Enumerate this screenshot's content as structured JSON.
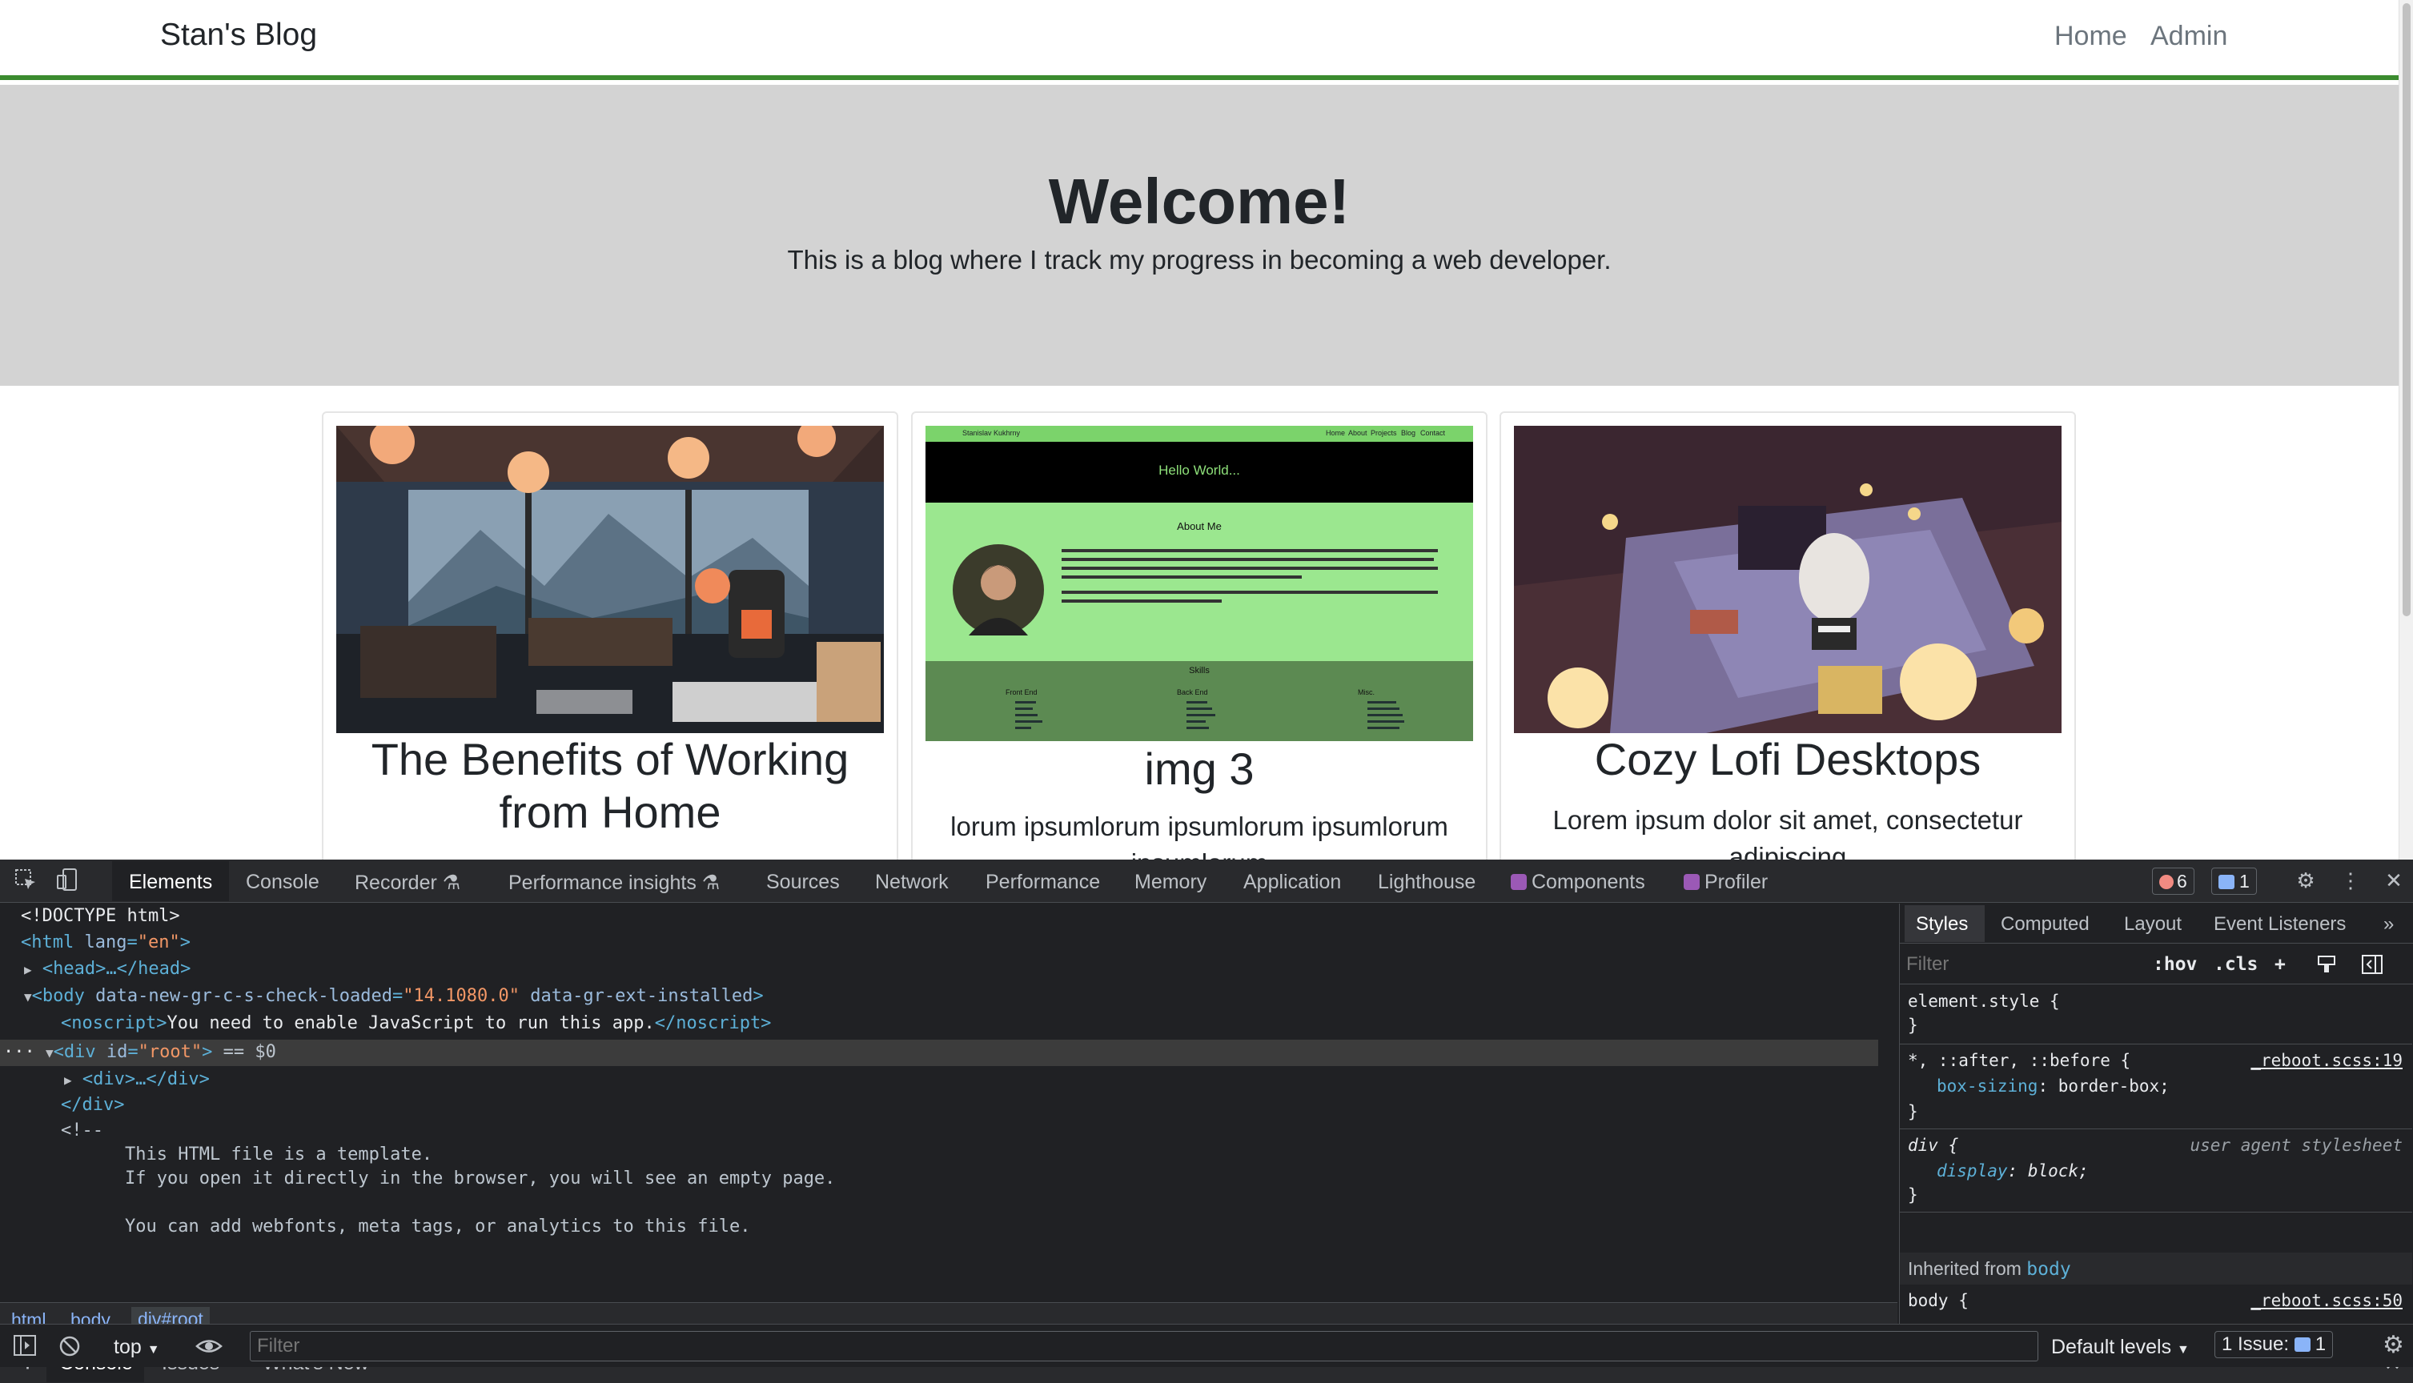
{
  "page": {
    "brand": "Stan's Blog",
    "nav": {
      "home": "Home",
      "admin": "Admin"
    },
    "hero": {
      "title": "Welcome!",
      "subtitle": "This is a blog where I track my progress in becoming a web developer."
    },
    "cards": [
      {
        "title": "The Benefits of Working from Home",
        "text": ""
      },
      {
        "title": "img 3",
        "text": "lorum ipsumlorum ipsumlorum ipsumlorum ipsumlorum"
      },
      {
        "title": "Cozy Lofi Desktops",
        "text": "Lorem ipsum dolor sit amet, consectetur adipiscing"
      }
    ],
    "screenshot_card": {
      "name": "Stanislav Kukhrny",
      "nav_items": [
        "Home",
        "About",
        "Projects",
        "Blog",
        "Contact"
      ],
      "hello": "Hello World...",
      "about_heading": "About Me",
      "skills_heading": "Skills",
      "skill_cols": [
        "Front End",
        "Back End",
        "Misc."
      ]
    }
  },
  "devtools": {
    "tabs": [
      "Elements",
      "Console",
      "Recorder",
      "Performance insights",
      "Sources",
      "Network",
      "Performance",
      "Memory",
      "Application",
      "Lighthouse",
      "Components",
      "Profiler"
    ],
    "active_tab": "Elements",
    "error_count": "6",
    "message_count": "1",
    "dom": {
      "doctype": "<!DOCTYPE html>",
      "html_open": "<html",
      "lang_attr": "lang",
      "lang_val": "\"en\"",
      "head": "<head>…</head>",
      "body_tag": "<body",
      "body_attr1": "data-new-gr-c-s-check-loaded",
      "body_val1": "\"14.1080.0\"",
      "body_attr2": "data-gr-ext-installed",
      "noscript_open": "<noscript>",
      "noscript_text": "You need to enable JavaScript to run this app.",
      "noscript_close": "</noscript>",
      "root_div": "<div",
      "root_attr": "id",
      "root_val": "\"root\"",
      "root_eq": "== $0",
      "child_div": "<div>…</div>",
      "close_div": "</div>",
      "comment_open": "<!--",
      "comment_line1": "This HTML file is a template.",
      "comment_line2": "If you open it directly in the browser, you will see an empty page.",
      "comment_line3": "You can add webfonts, meta tags, or analytics to this file."
    },
    "breadcrumbs": [
      "html",
      "body",
      "div#root"
    ],
    "styles": {
      "tabs": [
        "Styles",
        "Computed",
        "Layout",
        "Event Listeners"
      ],
      "filter_placeholder": "Filter",
      "hov": ":hov",
      "cls": ".cls",
      "rule1_selector": "element.style {",
      "rule2_selector": "*, ::after, ::before {",
      "rule2_source": "_reboot.scss:19",
      "rule2_prop": "box-sizing",
      "rule2_value": "border-box;",
      "rule3_selector": "div {",
      "rule3_source": "user agent stylesheet",
      "rule3_prop": "display",
      "rule3_value": "block;",
      "inherited_label": "Inherited from",
      "inherited_from": "body",
      "rule4_selector": "body {",
      "rule4_source": "_reboot.scss:50"
    },
    "drawer": {
      "tabs": [
        "Console",
        "Issues",
        "What's New"
      ],
      "context": "top",
      "filter_placeholder": "Filter",
      "levels": "Default levels",
      "issues_label": "1 Issue:",
      "issues_count": "1"
    }
  }
}
